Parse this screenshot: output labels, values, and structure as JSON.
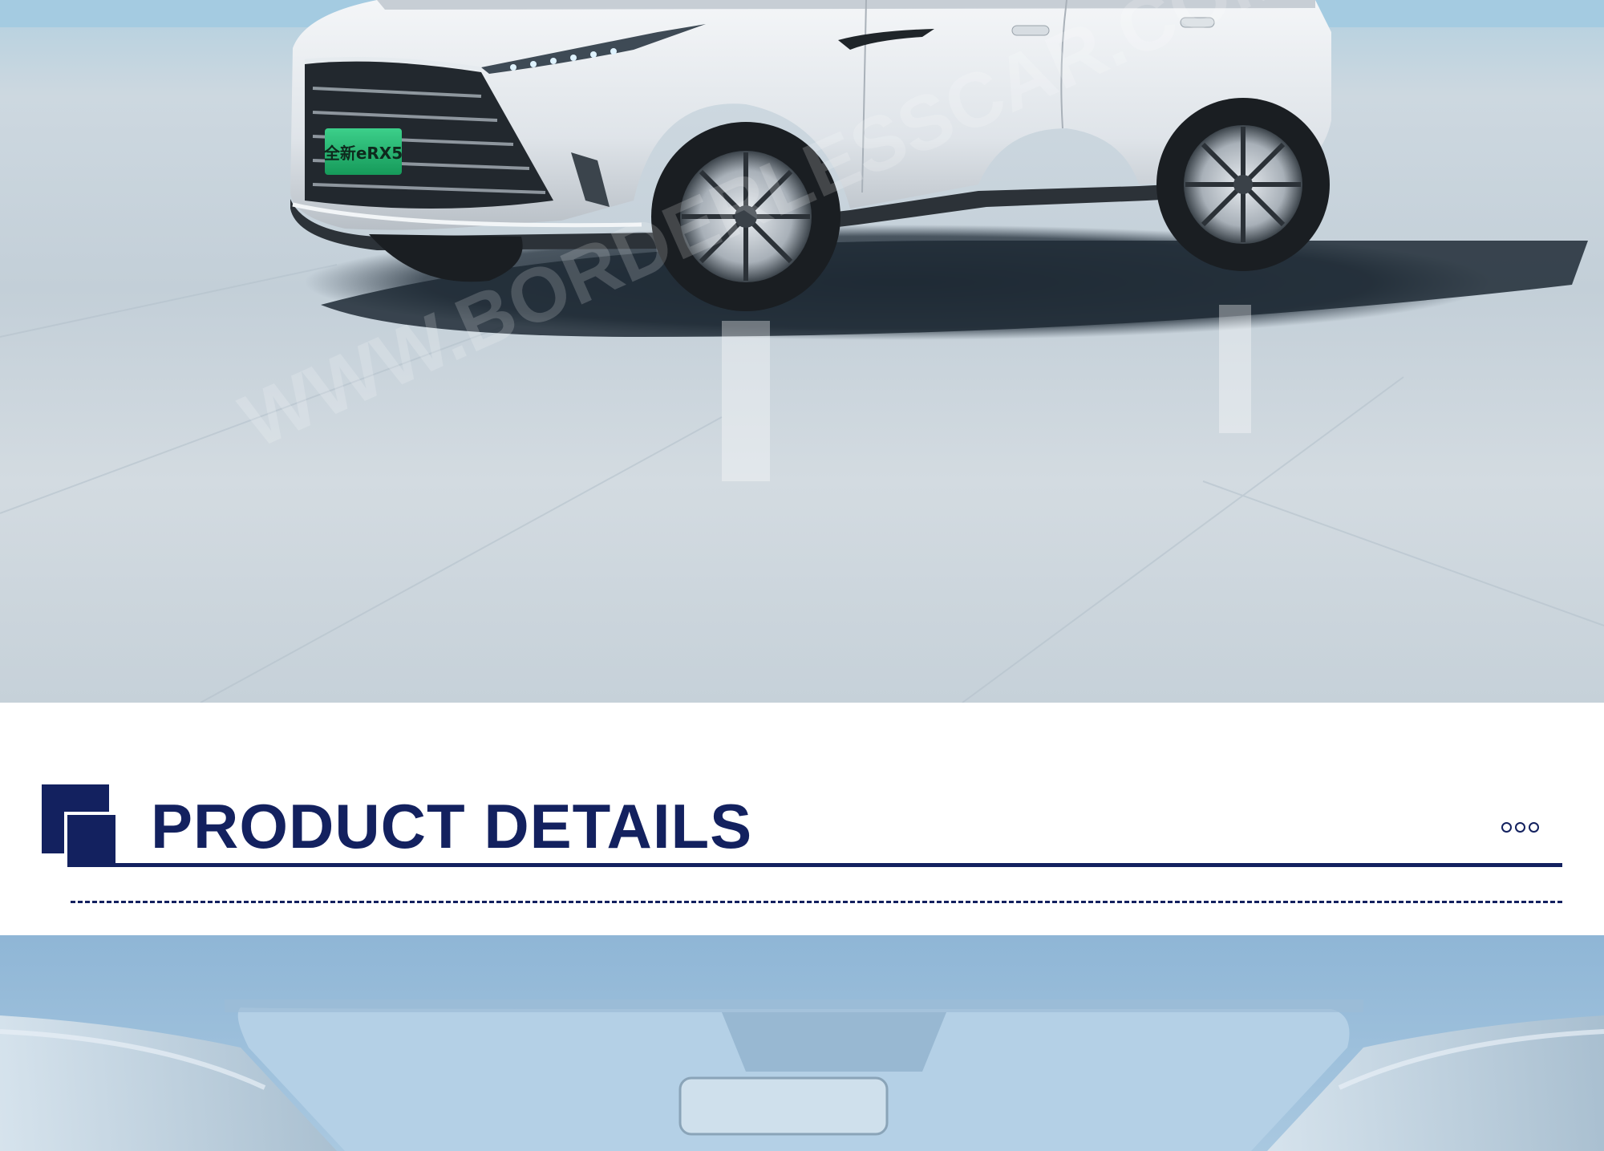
{
  "hero": {
    "image_name": "car-front-image",
    "plate_text": "全新eRX5",
    "watermark": "WWW.BORDERLESSCAR.COM"
  },
  "section": {
    "title": "PRODUCT DETAILS",
    "decoration_icon": "three-circles-icon"
  },
  "interior": {
    "image_name": "car-interior-image"
  },
  "colors": {
    "navy": "#13215f",
    "plate_green": "#2bb673",
    "sky": "#9fc6dd"
  }
}
